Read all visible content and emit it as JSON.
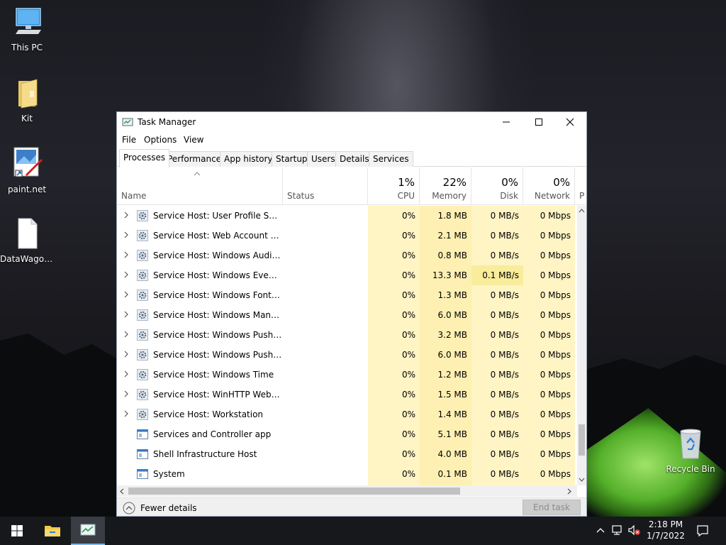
{
  "desktop": {
    "icons": [
      {
        "label": "This PC",
        "icon": "computer-icon"
      },
      {
        "label": "Kit",
        "icon": "folder-icon"
      },
      {
        "label": "paint.net",
        "icon": "paintnet-icon"
      },
      {
        "label": "DataWagon...",
        "icon": "document-icon"
      },
      {
        "label": "Recycle Bin",
        "icon": "recycle-bin-icon"
      }
    ]
  },
  "window": {
    "title": "Task Manager",
    "controls": {
      "minimize": "minimize-icon",
      "maximize": "maximize-icon",
      "close": "close-icon"
    }
  },
  "menu": [
    "File",
    "Options",
    "View"
  ],
  "tabs": [
    "Processes",
    "Performance",
    "App history",
    "Startup",
    "Users",
    "Details",
    "Services"
  ],
  "active_tab": "Processes",
  "columns": {
    "name": "Name",
    "status": "Status",
    "cpu": {
      "pct": "1%",
      "label": "CPU"
    },
    "memory": {
      "pct": "22%",
      "label": "Memory"
    },
    "disk": {
      "pct": "0%",
      "label": "Disk"
    },
    "network": {
      "pct": "0%",
      "label": "Network"
    },
    "partial": "P"
  },
  "processes": [
    {
      "name": "Service Host: User Profile Service",
      "expandable": true,
      "icon": "gear-icon",
      "cpu": "0%",
      "memory": "1.8 MB",
      "disk": "0 MB/s",
      "network": "0 Mbps"
    },
    {
      "name": "Service Host: Web Account Ma...",
      "expandable": true,
      "icon": "gear-icon",
      "cpu": "0%",
      "memory": "2.1 MB",
      "disk": "0 MB/s",
      "network": "0 Mbps"
    },
    {
      "name": "Service Host: Windows Audio E...",
      "expandable": true,
      "icon": "gear-icon",
      "cpu": "0%",
      "memory": "0.8 MB",
      "disk": "0 MB/s",
      "network": "0 Mbps"
    },
    {
      "name": "Service Host: Windows Event Log",
      "expandable": true,
      "icon": "gear-icon",
      "cpu": "0%",
      "memory": "13.3 MB",
      "disk": "0.1 MB/s",
      "network": "0 Mbps"
    },
    {
      "name": "Service Host: Windows Font Ca...",
      "expandable": true,
      "icon": "gear-icon",
      "cpu": "0%",
      "memory": "1.3 MB",
      "disk": "0 MB/s",
      "network": "0 Mbps"
    },
    {
      "name": "Service Host: Windows Manage...",
      "expandable": true,
      "icon": "gear-icon",
      "cpu": "0%",
      "memory": "6.0 MB",
      "disk": "0 MB/s",
      "network": "0 Mbps"
    },
    {
      "name": "Service Host: Windows Push No...",
      "expandable": true,
      "icon": "gear-icon",
      "cpu": "0%",
      "memory": "3.2 MB",
      "disk": "0 MB/s",
      "network": "0 Mbps"
    },
    {
      "name": "Service Host: Windows Push No...",
      "expandable": true,
      "icon": "gear-icon",
      "cpu": "0%",
      "memory": "6.0 MB",
      "disk": "0 MB/s",
      "network": "0 Mbps"
    },
    {
      "name": "Service Host: Windows Time",
      "expandable": true,
      "icon": "gear-icon",
      "cpu": "0%",
      "memory": "1.2 MB",
      "disk": "0 MB/s",
      "network": "0 Mbps"
    },
    {
      "name": "Service Host: WinHTTP Web Pro...",
      "expandable": true,
      "icon": "gear-icon",
      "cpu": "0%",
      "memory": "1.5 MB",
      "disk": "0 MB/s",
      "network": "0 Mbps"
    },
    {
      "name": "Service Host: Workstation",
      "expandable": true,
      "icon": "gear-icon",
      "cpu": "0%",
      "memory": "1.4 MB",
      "disk": "0 MB/s",
      "network": "0 Mbps"
    },
    {
      "name": "Services and Controller app",
      "expandable": false,
      "icon": "window-app-icon",
      "cpu": "0%",
      "memory": "5.1 MB",
      "disk": "0 MB/s",
      "network": "0 Mbps"
    },
    {
      "name": "Shell Infrastructure Host",
      "expandable": false,
      "icon": "window-app-icon",
      "cpu": "0%",
      "memory": "4.0 MB",
      "disk": "0 MB/s",
      "network": "0 Mbps"
    },
    {
      "name": "System",
      "expandable": false,
      "icon": "window-app-icon",
      "cpu": "0%",
      "memory": "0.1 MB",
      "disk": "0 MB/s",
      "network": "0 Mbps"
    }
  ],
  "footer": {
    "fewer_details": "Fewer details",
    "end_task": "End task"
  },
  "taskbar": {
    "time": "2:18 PM",
    "date": "1/7/2022",
    "items": [
      "start-icon",
      "file-explorer-icon",
      "task-manager-icon"
    ],
    "tray": [
      "chevron-up-icon",
      "network-icon",
      "volume-muted-icon",
      "notification-icon"
    ]
  },
  "colors": {
    "cpu_heat": "#fff4c4",
    "memory_heat": "#fdf0b2",
    "disk_heat_light": "#fff4c4",
    "disk_heat_strong": "#f9ec9a",
    "taskbar": "#16181c",
    "accent": "#76b9ed"
  }
}
